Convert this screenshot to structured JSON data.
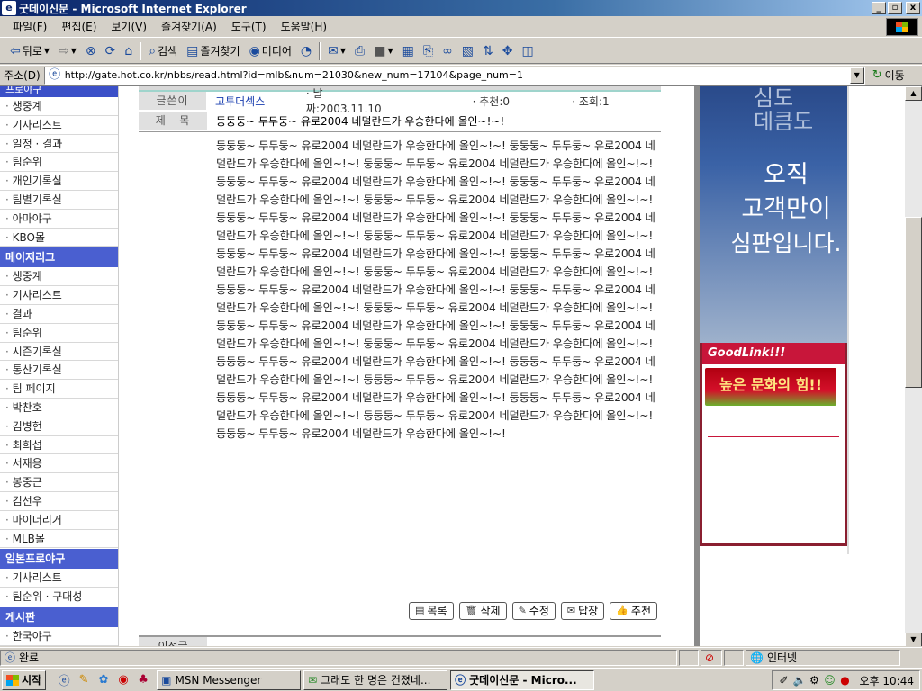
{
  "window": {
    "title": "굿데이신문 - Microsoft Internet Explorer",
    "controls": [
      "_",
      "▫",
      "x"
    ]
  },
  "menu": [
    "파일(F)",
    "편집(E)",
    "보기(V)",
    "즐겨찾기(A)",
    "도구(T)",
    "도움말(H)"
  ],
  "toolbar": {
    "back": "뒤로",
    "search": "검색",
    "favorites": "즐겨찾기",
    "media": "미디어"
  },
  "address": {
    "label": "주소(D)",
    "url": "http://gate.hot.co.kr/nbbs/read.html?id=mlb&num=21030&new_num=17104&page_num=1",
    "go": "이동"
  },
  "sidebar": {
    "top_cut": "프로야구",
    "group1": [
      "생중계",
      "기사리스트",
      "일정 · 결과",
      "팀순위",
      "개인기록실",
      "팀별기록실",
      "아마야구",
      "KBO몰"
    ],
    "header2": "메이저리그",
    "group2": [
      "생중계",
      "기사리스트",
      "결과",
      "팀순위",
      "시즌기록실",
      "통산기록실",
      "팀 페이지",
      "박찬호",
      "김병현",
      "최희섭",
      "서재응",
      "봉중근",
      "김선우",
      "마이너리거",
      "MLB몰"
    ],
    "header3": "일본프로야구",
    "group3": [
      "기사리스트",
      "팀순위 · 구대성"
    ],
    "header4": "게시판",
    "group4": [
      "한국야구"
    ]
  },
  "article": {
    "author_label": "글쓴이",
    "author": "고투더섹스",
    "date": "· 날짜:2003.11.10",
    "recommend": "· 추천:0",
    "views": "· 조회:1",
    "subject_label": "제   목",
    "subject": "둥둥둥~ 두두둥~ 유로2004 네덜란드가 우승한다에 올인~!~!",
    "body": "둥둥둥~ 두두둥~ 유로2004 네덜란드가 우승한다에 올인~!~! 둥둥둥~ 두두둥~ 유로2004 네덜란드가 우승한다에 올인~!~! 둥둥둥~ 두두둥~ 유로2004 네덜란드가 우승한다에 올인~!~! 둥둥둥~ 두두둥~ 유로2004 네덜란드가 우승한다에 올인~!~! 둥둥둥~ 두두둥~ 유로2004 네덜란드가 우승한다에 올인~!~! 둥둥둥~ 두두둥~ 유로2004 네덜란드가 우승한다에 올인~!~! 둥둥둥~ 두두둥~ 유로2004 네덜란드가 우승한다에 올인~!~! 둥둥둥~ 두두둥~ 유로2004 네덜란드가 우승한다에 올인~!~! 둥둥둥~ 두두둥~ 유로2004 네덜란드가 우승한다에 올인~!~! 둥둥둥~ 두두둥~ 유로2004 네덜란드가 우승한다에 올인~!~! 둥둥둥~ 두두둥~ 유로2004 네덜란드가 우승한다에 올인~!~! 둥둥둥~ 두두둥~ 유로2004 네덜란드가 우승한다에 올인~!~! 둥둥둥~ 두두둥~ 유로2004 네덜란드가 우승한다에 올인~!~! 둥둥둥~ 두두둥~ 유로2004 네덜란드가 우승한다에 올인~!~! 둥둥둥~ 두두둥~ 유로2004 네덜란드가 우승한다에 올인~!~! 둥둥둥~ 두두둥~ 유로2004 네덜란드가 우승한다에 올인~!~! 둥둥둥~ 두두둥~ 유로2004 네덜란드가 우승한다에 올인~!~! 둥둥둥~ 두두둥~ 유로2004 네덜란드가 우승한다에 올인~!~! 둥둥둥~ 두두둥~ 유로2004 네덜란드가 우승한다에 올인~!~! 둥둥둥~ 두두둥~ 유로2004 네덜란드가 우승한다에 올인~!~! 둥둥둥~ 두두둥~ 유로2004 네덜란드가 우승한다에 올인~!~! 둥둥둥~ 두두둥~ 유로2004 네덜란드가 우승한다에 올인~!~! 둥둥둥~ 두두둥~ 유로2004 네덜란드가 우승한다에 올인~!~! 둥둥둥~ 두두둥~ 유로2004 네덜란드가 우승한다에 올인~!~! 둥둥둥~ 두두둥~ 유로2004 네덜란드가 우승한다에 올인~!~!",
    "buttons": {
      "list": "목록",
      "delete": "삭제",
      "edit": "수정",
      "reply": "답장",
      "recommend": "추천"
    },
    "prev_label": "이전글"
  },
  "banner": {
    "faint": [
      "심도",
      "데큼도"
    ],
    "slogan_lines": [
      "오직",
      "고객만이",
      "심판입니다."
    ],
    "goodlink_title": "GoodLink!!!",
    "goodlink_ad": "높은 문화의 힘!!"
  },
  "status": {
    "left": "완료",
    "zone": "인터넷"
  },
  "taskbar": {
    "start": "시작",
    "tasks": [
      "MSN Messenger",
      "그래도 한 명은 건졌네...",
      "굿데이신문 - Micro..."
    ],
    "clock": "오후 10:44"
  },
  "colors": {
    "sidebar_header": "#4a5fd0",
    "goodlink_red": "#c8163a",
    "author_link": "#1a3fb0"
  }
}
